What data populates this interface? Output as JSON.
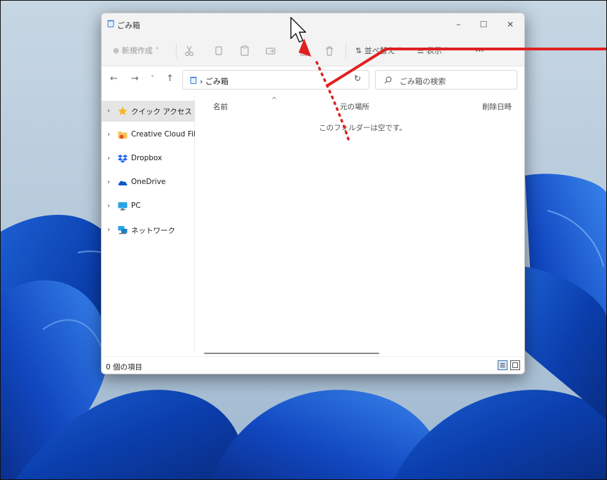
{
  "window": {
    "title": "ごみ箱",
    "controls": {
      "minimize": "–",
      "maximize": "☐",
      "close": "✕"
    }
  },
  "toolbar": {
    "new_label": "⊕ 新規作成 ˅",
    "sort_label": "⇅ 並べ替え ˅",
    "view_label": "☰ 表示 ˅",
    "more_label": "···"
  },
  "address": {
    "path": "› ごみ箱",
    "chevron": "˅",
    "refresh": "↻"
  },
  "search": {
    "placeholder": "ごみ箱の検索"
  },
  "nav_buttons": {
    "back": "←",
    "forward": "→",
    "recent": "˅",
    "up": "↑"
  },
  "sidebar": {
    "items": [
      {
        "label": "クイック アクセス",
        "icon": "star-icon"
      },
      {
        "label": "Creative Cloud Files",
        "icon": "creative-cloud-folder-icon"
      },
      {
        "label": "Dropbox",
        "icon": "dropbox-icon"
      },
      {
        "label": "OneDrive",
        "icon": "onedrive-cloud-icon"
      },
      {
        "label": "PC",
        "icon": "monitor-icon"
      },
      {
        "label": "ネットワーク",
        "icon": "network-icon"
      }
    ],
    "chevron": "›"
  },
  "columns": {
    "name": "名前",
    "original_location": "元の場所",
    "date_deleted": "削除日時",
    "sort_caret": "^"
  },
  "content": {
    "empty_message": "このフォルダーは空です。"
  },
  "status": {
    "item_count": "0 個の項目"
  },
  "colors": {
    "annotation_red": "#e02020",
    "window_chrome": "#f3f3f3",
    "selection": "#e5e5e5",
    "accent_blue": "#2b63c7"
  }
}
